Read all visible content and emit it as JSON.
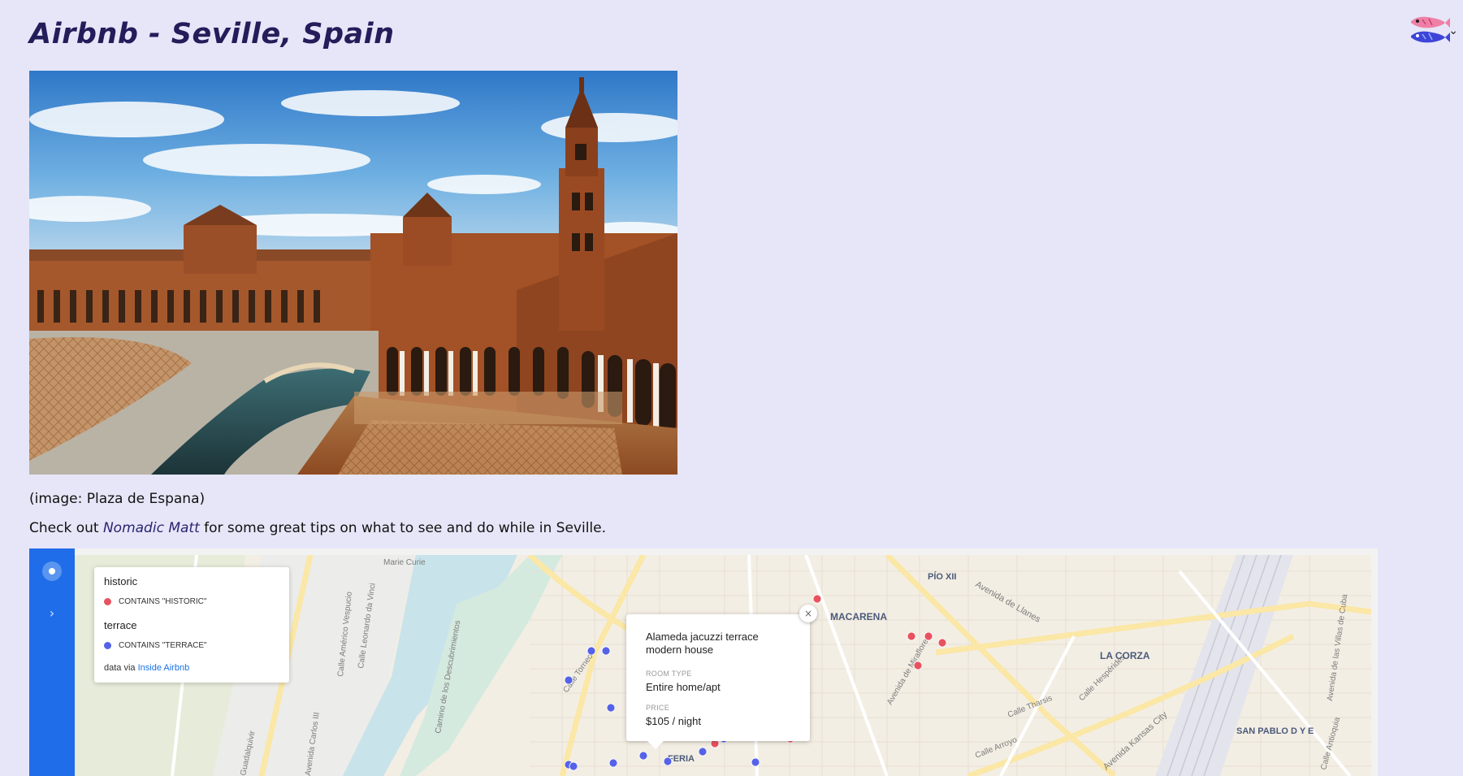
{
  "page": {
    "title": "Airbnb - Seville, Spain",
    "image_caption": "(image: Plaza de Espana)",
    "tips": {
      "before": "Check out ",
      "link": "Nomadic Matt",
      "after": " for some great tips on what to see and do while in Seville."
    }
  },
  "map": {
    "legend": {
      "layers": [
        {
          "title": "historic",
          "item": "CONTAINS \"HISTORIC\"",
          "color": "#e8525f"
        },
        {
          "title": "terrace",
          "item": "CONTAINS \"TERRACE\"",
          "color": "#5562e8"
        }
      ],
      "source_prefix": "data via ",
      "source_link": "Inside Airbnb"
    },
    "popup": {
      "title": "Alameda jacuzzi terrace modern house",
      "room_type_label": "ROOM TYPE",
      "room_type_value": "Entire home/apt",
      "price_label": "PRICE",
      "price_value": "$105 / night"
    },
    "labels": {
      "pio_xii": "PÍO XII",
      "macarena": "MACARENA",
      "la_corza": "LA CORZA",
      "san_pablo": "SAN PABLO D Y E",
      "feria": "FERIA",
      "marie_curie": "Marie Curie",
      "calle_torneo": "Calle Torneo",
      "avenida_llanes": "Avenida de Llanes",
      "avenida_miraflores": "Avenida de Miraflores",
      "calle_tharsis": "Calle Tharsis",
      "calle_hesperides": "Calle Hespérides",
      "calle_arroyo": "Calle Arroyo",
      "avenida_kansas": "Avenida Kansas City",
      "avenida_carlos": "Avenida Carlos III",
      "camino_descubrimientos": "Camino de los Descubrimientos",
      "calle_americo": "Calle Américo Vespucio",
      "calle_leonardo": "Calle Leonardo da Vinci",
      "guadalquivir": "Guadalquivir",
      "avenida_villas_cuba": "Avenida de las Villas de Cuba",
      "calle_antioquia": "Calle Antioquia"
    }
  },
  "colors": {
    "page_bg": "#e6e6f8",
    "title": "#231d5a",
    "historic": "#e8525f",
    "terrace": "#5562e8",
    "sidebar": "#1f6de8"
  }
}
